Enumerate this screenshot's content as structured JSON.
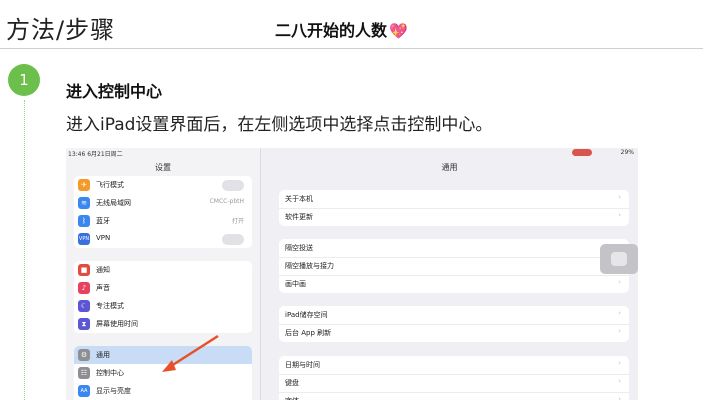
{
  "header": {
    "title": "方法/步骤",
    "subtitle": "二八开始的人数",
    "heart": "💖"
  },
  "step": {
    "number": "1",
    "title": "进入控制中心",
    "description": "进入iPad设置界面后，在左侧选项中选择点击控制中心。"
  },
  "screenshot": {
    "status_left": "13:46  6月21日周二",
    "status_right": "29%",
    "sidebar_title": "设置",
    "detail_title": "通用",
    "sidebar_group1": [
      {
        "label": "飞行模式",
        "icon": "airplane-icon",
        "color": "#f39a2b",
        "value": ""
      },
      {
        "label": "无线局域网",
        "icon": "wifi-icon",
        "color": "#3a87f0",
        "value": "CMCC-pbtH"
      },
      {
        "label": "蓝牙",
        "icon": "bluetooth-icon",
        "color": "#3a87f0",
        "value": "打开"
      },
      {
        "label": "VPN",
        "icon": "vpn-icon",
        "color": "#3a6fe0",
        "value": ""
      }
    ],
    "sidebar_group2": [
      {
        "label": "通知",
        "icon": "notification-icon",
        "color": "#e24b3f"
      },
      {
        "label": "声音",
        "icon": "sound-icon",
        "color": "#e84060"
      },
      {
        "label": "专注模式",
        "icon": "moon-icon",
        "color": "#5c55d4"
      },
      {
        "label": "屏幕使用时间",
        "icon": "hourglass-icon",
        "color": "#5c55d4"
      }
    ],
    "sidebar_group3": [
      {
        "label": "通用",
        "icon": "gear-icon",
        "color": "#8e8e93"
      },
      {
        "label": "控制中心",
        "icon": "switches-icon",
        "color": "#8e8e93"
      },
      {
        "label": "显示与亮度",
        "icon": "brightness-icon",
        "color": "#3a87f0"
      }
    ],
    "detail_group1": [
      "关于本机",
      "软件更新"
    ],
    "detail_group2": [
      "隔空投送",
      "隔空播放与接力",
      "画中画"
    ],
    "detail_group3": [
      "iPad储存空间",
      "后台 App 刷新"
    ],
    "detail_group4": [
      "日期与时间",
      "键盘",
      "字体"
    ],
    "arrow_color": "#e8502a",
    "accent_color": "#6dbf4b"
  }
}
